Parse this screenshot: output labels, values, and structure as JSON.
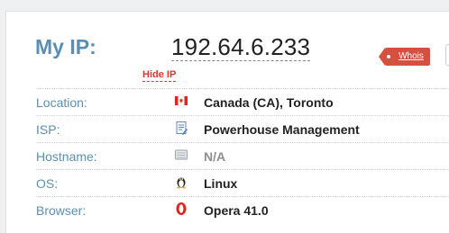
{
  "header": {
    "my_ip_label": "My IP:",
    "ip_address": "192.64.6.233",
    "hide_ip_label": "Hide IP",
    "whois_label": "Whois"
  },
  "details": {
    "location": {
      "label": "Location:",
      "value": "Canada (CA), Toronto",
      "icon": "canada-flag-icon"
    },
    "isp": {
      "label": "ISP:",
      "value": "Powerhouse Management",
      "icon": "isp-document-icon"
    },
    "hostname": {
      "label": "Hostname:",
      "value": "N/A",
      "icon": "server-icon"
    },
    "os": {
      "label": "OS:",
      "value": "Linux",
      "icon": "linux-tux-icon"
    },
    "browser": {
      "label": "Browser:",
      "value": "Opera 41.0",
      "icon": "opera-icon"
    }
  },
  "colors": {
    "label_blue": "#5b8fb3",
    "accent_red": "#d5503f",
    "hide_ip_red": "#e0352b"
  }
}
